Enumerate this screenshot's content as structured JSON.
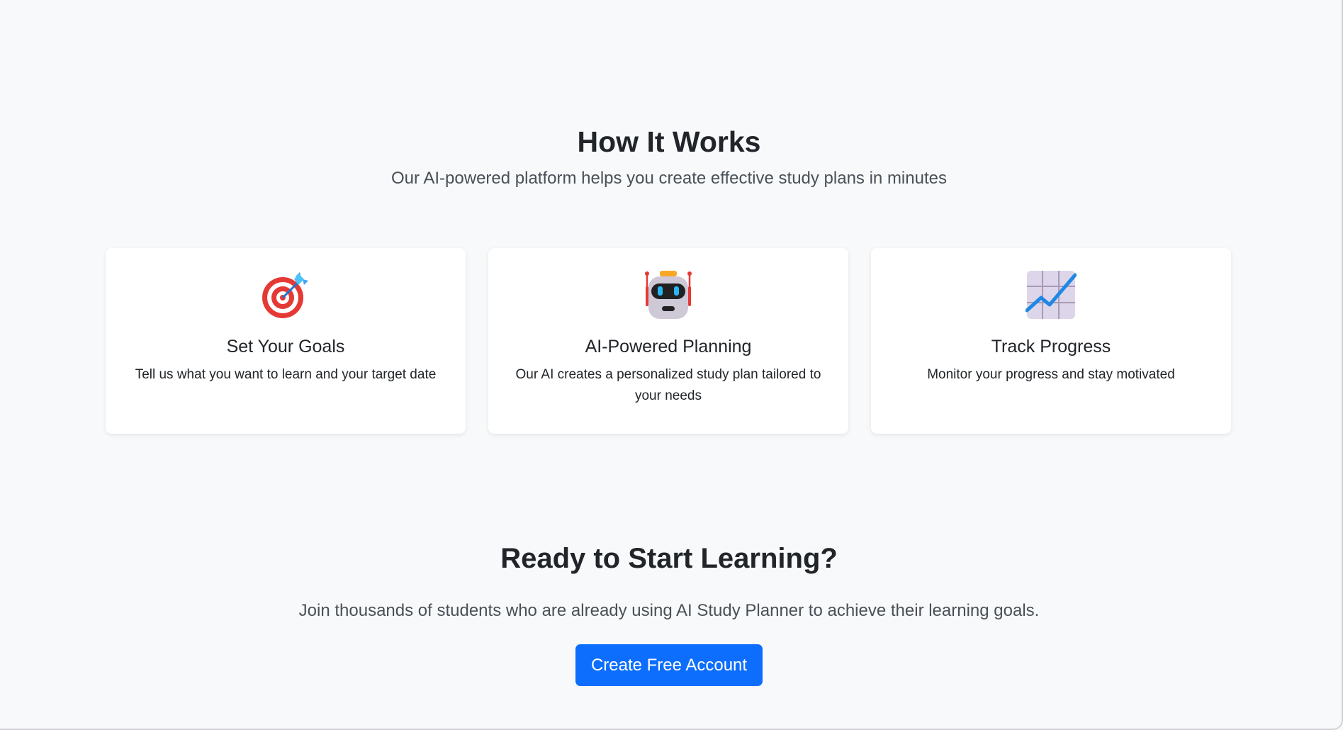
{
  "how_it_works": {
    "title": "How It Works",
    "subtitle": "Our AI-powered platform helps you create effective study plans in minutes",
    "cards": [
      {
        "icon": "target-dart-icon",
        "title": "Set Your Goals",
        "text": "Tell us what you want to learn and your target date"
      },
      {
        "icon": "robot-icon",
        "title": "AI-Powered Planning",
        "text": "Our AI creates a personalized study plan tailored to your needs"
      },
      {
        "icon": "chart-increasing-icon",
        "title": "Track Progress",
        "text": "Monitor your progress and stay motivated"
      }
    ]
  },
  "cta": {
    "title": "Ready to Start Learning?",
    "text": "Join thousands of students who are already using AI Study Planner to achieve their learning goals.",
    "button_label": "Create Free Account"
  },
  "colors": {
    "background": "#f8f9fa",
    "card_background": "#ffffff",
    "primary_button": "#0d6efd",
    "heading_text": "#212529",
    "muted_text": "#495057"
  }
}
